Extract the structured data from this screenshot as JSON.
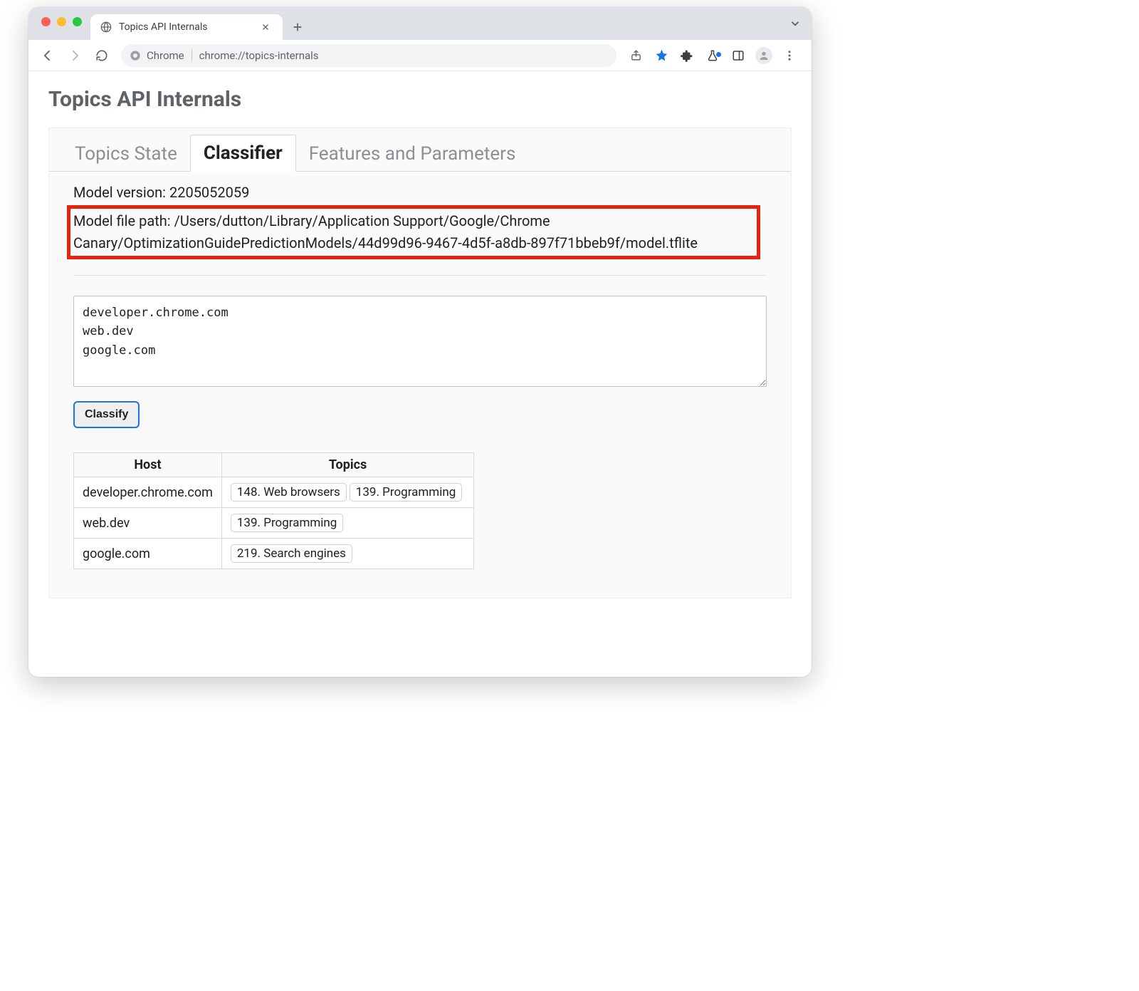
{
  "chrome": {
    "tab_title": "Topics API Internals",
    "omnibox_label": "Chrome",
    "url": "chrome://topics-internals"
  },
  "page": {
    "heading": "Topics API Internals",
    "tabs": [
      {
        "label": "Topics State",
        "active": false
      },
      {
        "label": "Classifier",
        "active": true
      },
      {
        "label": "Features and Parameters",
        "active": false
      }
    ],
    "model_version_label": "Model version:",
    "model_version": "2205052059",
    "model_path_label": "Model file path:",
    "model_path": "/Users/dutton/Library/Application Support/Google/Chrome Canary/OptimizationGuidePredictionModels/44d99d96-9467-4d5f-a8db-897f71bbeb9f/model.tflite",
    "hosts_input": "developer.chrome.com\nweb.dev\ngoogle.com",
    "classify_label": "Classify",
    "table": {
      "headers": [
        "Host",
        "Topics"
      ],
      "rows": [
        {
          "host": "developer.chrome.com",
          "topics": [
            "148. Web browsers",
            "139. Programming"
          ]
        },
        {
          "host": "web.dev",
          "topics": [
            "139. Programming"
          ]
        },
        {
          "host": "google.com",
          "topics": [
            "219. Search engines"
          ]
        }
      ]
    }
  }
}
